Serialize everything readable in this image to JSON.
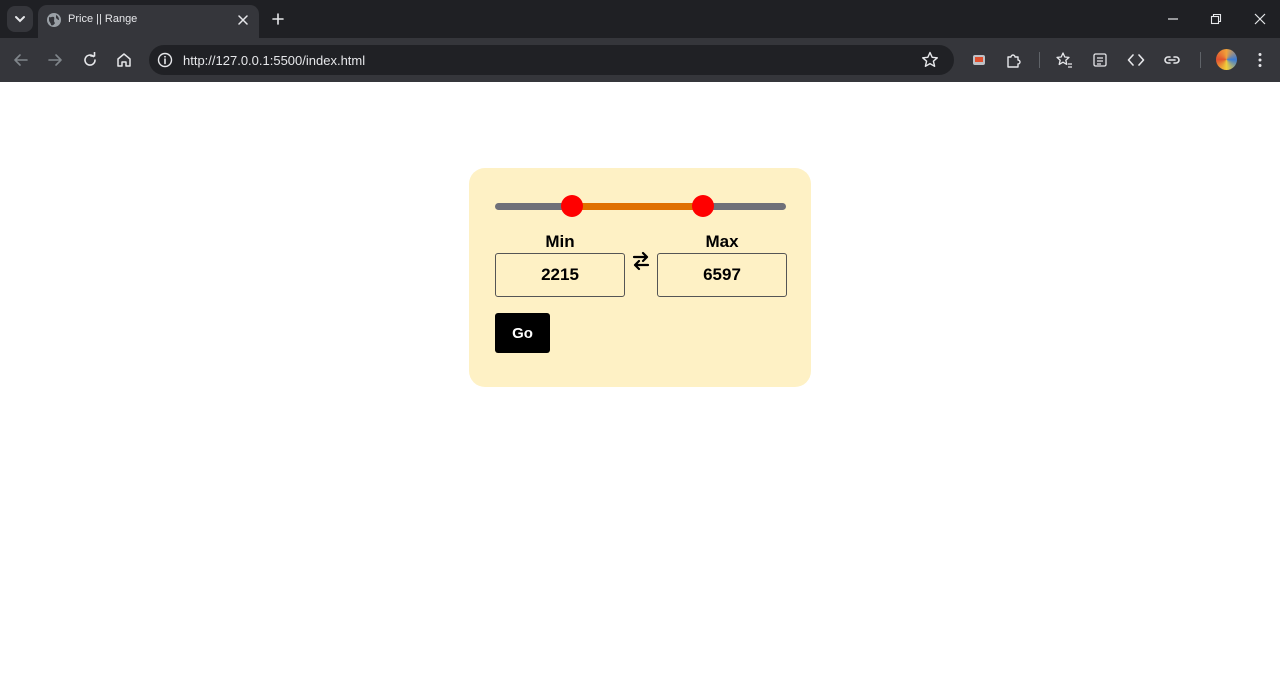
{
  "browser": {
    "tab_title": "Price || Range",
    "url": "http://127.0.0.1:5500/index.html"
  },
  "slider": {
    "min_value": 2215,
    "max_value": 6597,
    "range_min": 0,
    "range_max": 9000,
    "colors": {
      "track": "#6f7079",
      "fill": "#e07000",
      "thumb": "#ff0000"
    }
  },
  "inputs": {
    "min_label": "Min",
    "max_label": "Max",
    "min_value": "2215",
    "max_value": "6597"
  },
  "go_button": {
    "label": "Go"
  },
  "colors": {
    "card_bg": "#fef1c5",
    "button_bg": "#000000"
  }
}
